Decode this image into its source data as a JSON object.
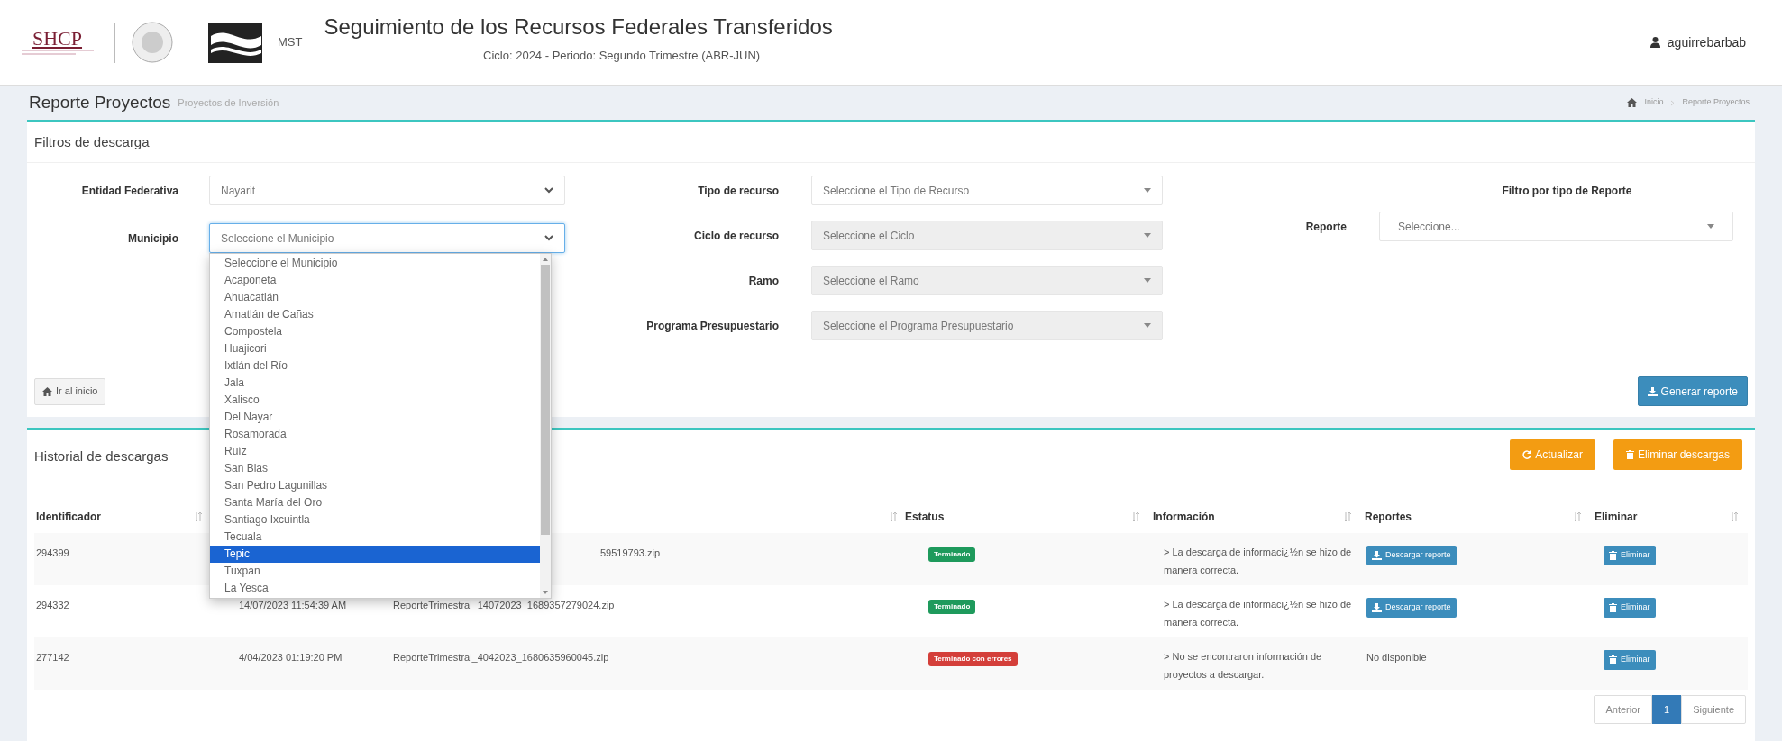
{
  "header": {
    "logo_text": "SHCP",
    "brand": "MST",
    "title": "Seguimiento de los Recursos Federales Transferidos",
    "subtitle": "Ciclo: 2024 - Periodo: Segundo Trimestre (ABR-JUN)",
    "user": "aguirrebarbab"
  },
  "page": {
    "title": "Reporte Proyectos",
    "subtitle": "Proyectos de Inversión",
    "breadcrumb": [
      "Inicio",
      "Reporte Proyectos"
    ]
  },
  "filters": {
    "title": "Filtros de descarga",
    "left_fields": [
      {
        "label": "Entidad Federativa",
        "value": "Nayarit",
        "focused": false
      },
      {
        "label": "Municipio",
        "value": "Seleccione el Municipio",
        "focused": true
      }
    ],
    "middle_fields": [
      {
        "label": "Tipo de recurso",
        "value": "Seleccione el Tipo de Recurso",
        "disabled": false
      },
      {
        "label": "Ciclo de recurso",
        "value": "Seleccione el Ciclo",
        "disabled": true
      },
      {
        "label": "Ramo",
        "value": "Seleccione el Ramo",
        "disabled": true
      },
      {
        "label": "Programa Presupuestario",
        "value": "Seleccione el Programa Presupuestario",
        "disabled": true
      }
    ],
    "report_filter": {
      "title": "Filtro por tipo de Reporte",
      "label": "Reporte",
      "value": "Seleccione..."
    },
    "home_button": "Ir al inicio",
    "generate_button": "Generar reporte"
  },
  "municipio_dropdown": {
    "options": [
      {
        "label": "Seleccione el Municipio",
        "selected": false
      },
      {
        "label": "Acaponeta",
        "selected": false
      },
      {
        "label": "Ahuacatlán",
        "selected": false
      },
      {
        "label": "Amatlán de Cañas",
        "selected": false
      },
      {
        "label": "Compostela",
        "selected": false
      },
      {
        "label": "Huajicori",
        "selected": false
      },
      {
        "label": "Ixtlán del Río",
        "selected": false
      },
      {
        "label": "Jala",
        "selected": false
      },
      {
        "label": "Xalisco",
        "selected": false
      },
      {
        "label": "Del Nayar",
        "selected": false
      },
      {
        "label": "Rosamorada",
        "selected": false
      },
      {
        "label": "Ruíz",
        "selected": false
      },
      {
        "label": "San Blas",
        "selected": false
      },
      {
        "label": "San Pedro Lagunillas",
        "selected": false
      },
      {
        "label": "Santa María del Oro",
        "selected": false
      },
      {
        "label": "Santiago Ixcuintla",
        "selected": false
      },
      {
        "label": "Tecuala",
        "selected": false
      },
      {
        "label": "Tepic",
        "selected": true
      },
      {
        "label": "Tuxpan",
        "selected": false
      },
      {
        "label": "La Yesca",
        "selected": false
      }
    ]
  },
  "history": {
    "title": "Historial de descargas",
    "refresh_button": "Actualizar",
    "delete_all_button": "Eliminar descargas",
    "columns": [
      "Identificador",
      "Estatus",
      "Información",
      "Reportes",
      "Eliminar"
    ],
    "rows": [
      {
        "id": "294399",
        "file": "59519793.zip",
        "status": {
          "text": "Terminado",
          "color": "#1e9a5c"
        },
        "info": "> La descarga de informaci¿½n se hizo de manera correcta.",
        "report": {
          "kind": "button",
          "text": "Descargar reporte"
        },
        "delete_button": "Eliminar"
      },
      {
        "id": "294332",
        "date": "14/07/2023 11:54:39 AM",
        "file": "ReporteTrimestral_14072023_1689357279024.zip",
        "status": {
          "text": "Terminado",
          "color": "#1e9a5c"
        },
        "info": "> La descarga de informaci¿½n se hizo de manera correcta.",
        "report": {
          "kind": "button",
          "text": "Descargar reporte"
        },
        "delete_button": "Eliminar"
      },
      {
        "id": "277142",
        "date": "4/04/2023 01:19:20 PM",
        "file": "ReporteTrimestral_4042023_1680635960045.zip",
        "status": {
          "text": "Terminado con errores",
          "color": "#d43f3a"
        },
        "info": "> No se encontraron información de proyectos a descargar.",
        "report": {
          "kind": "text",
          "text": "No disponible"
        },
        "delete_button": "Eliminar"
      }
    ],
    "pagination": {
      "previous": "Anterior",
      "pages": [
        {
          "label": "1",
          "selected": true
        }
      ],
      "next": "Siguiente"
    }
  }
}
